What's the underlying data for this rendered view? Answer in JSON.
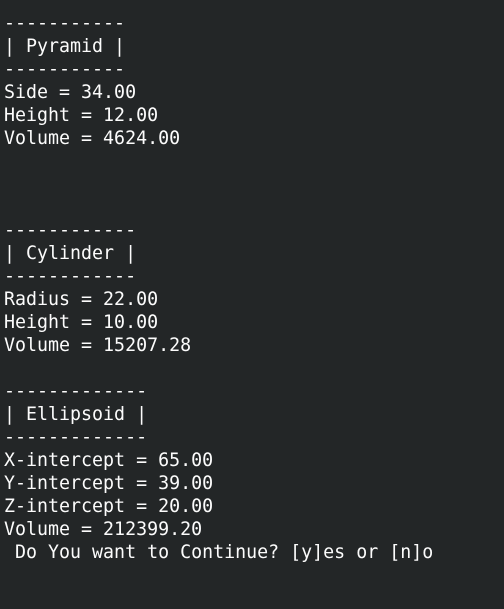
{
  "terminal": {
    "pyramid": {
      "rule": "-----------",
      "title": "| Pyramid |",
      "side": "Side = 34.00",
      "height": "Height = 12.00",
      "volume": "Volume = 4624.00"
    },
    "cylinder": {
      "rule": "------------",
      "title": "| Cylinder |",
      "radius": "Radius = 22.00",
      "height": "Height = 10.00",
      "volume": "Volume = 15207.28"
    },
    "ellipsoid": {
      "rule": "-------------",
      "title": "| Ellipsoid |",
      "x_intercept": "X-intercept = 65.00",
      "y_intercept": "Y-intercept = 39.00",
      "z_intercept": "Z-intercept = 20.00",
      "volume": "Volume = 212399.20"
    },
    "prompt": " Do You want to Continue? [y]es or [n]o"
  }
}
